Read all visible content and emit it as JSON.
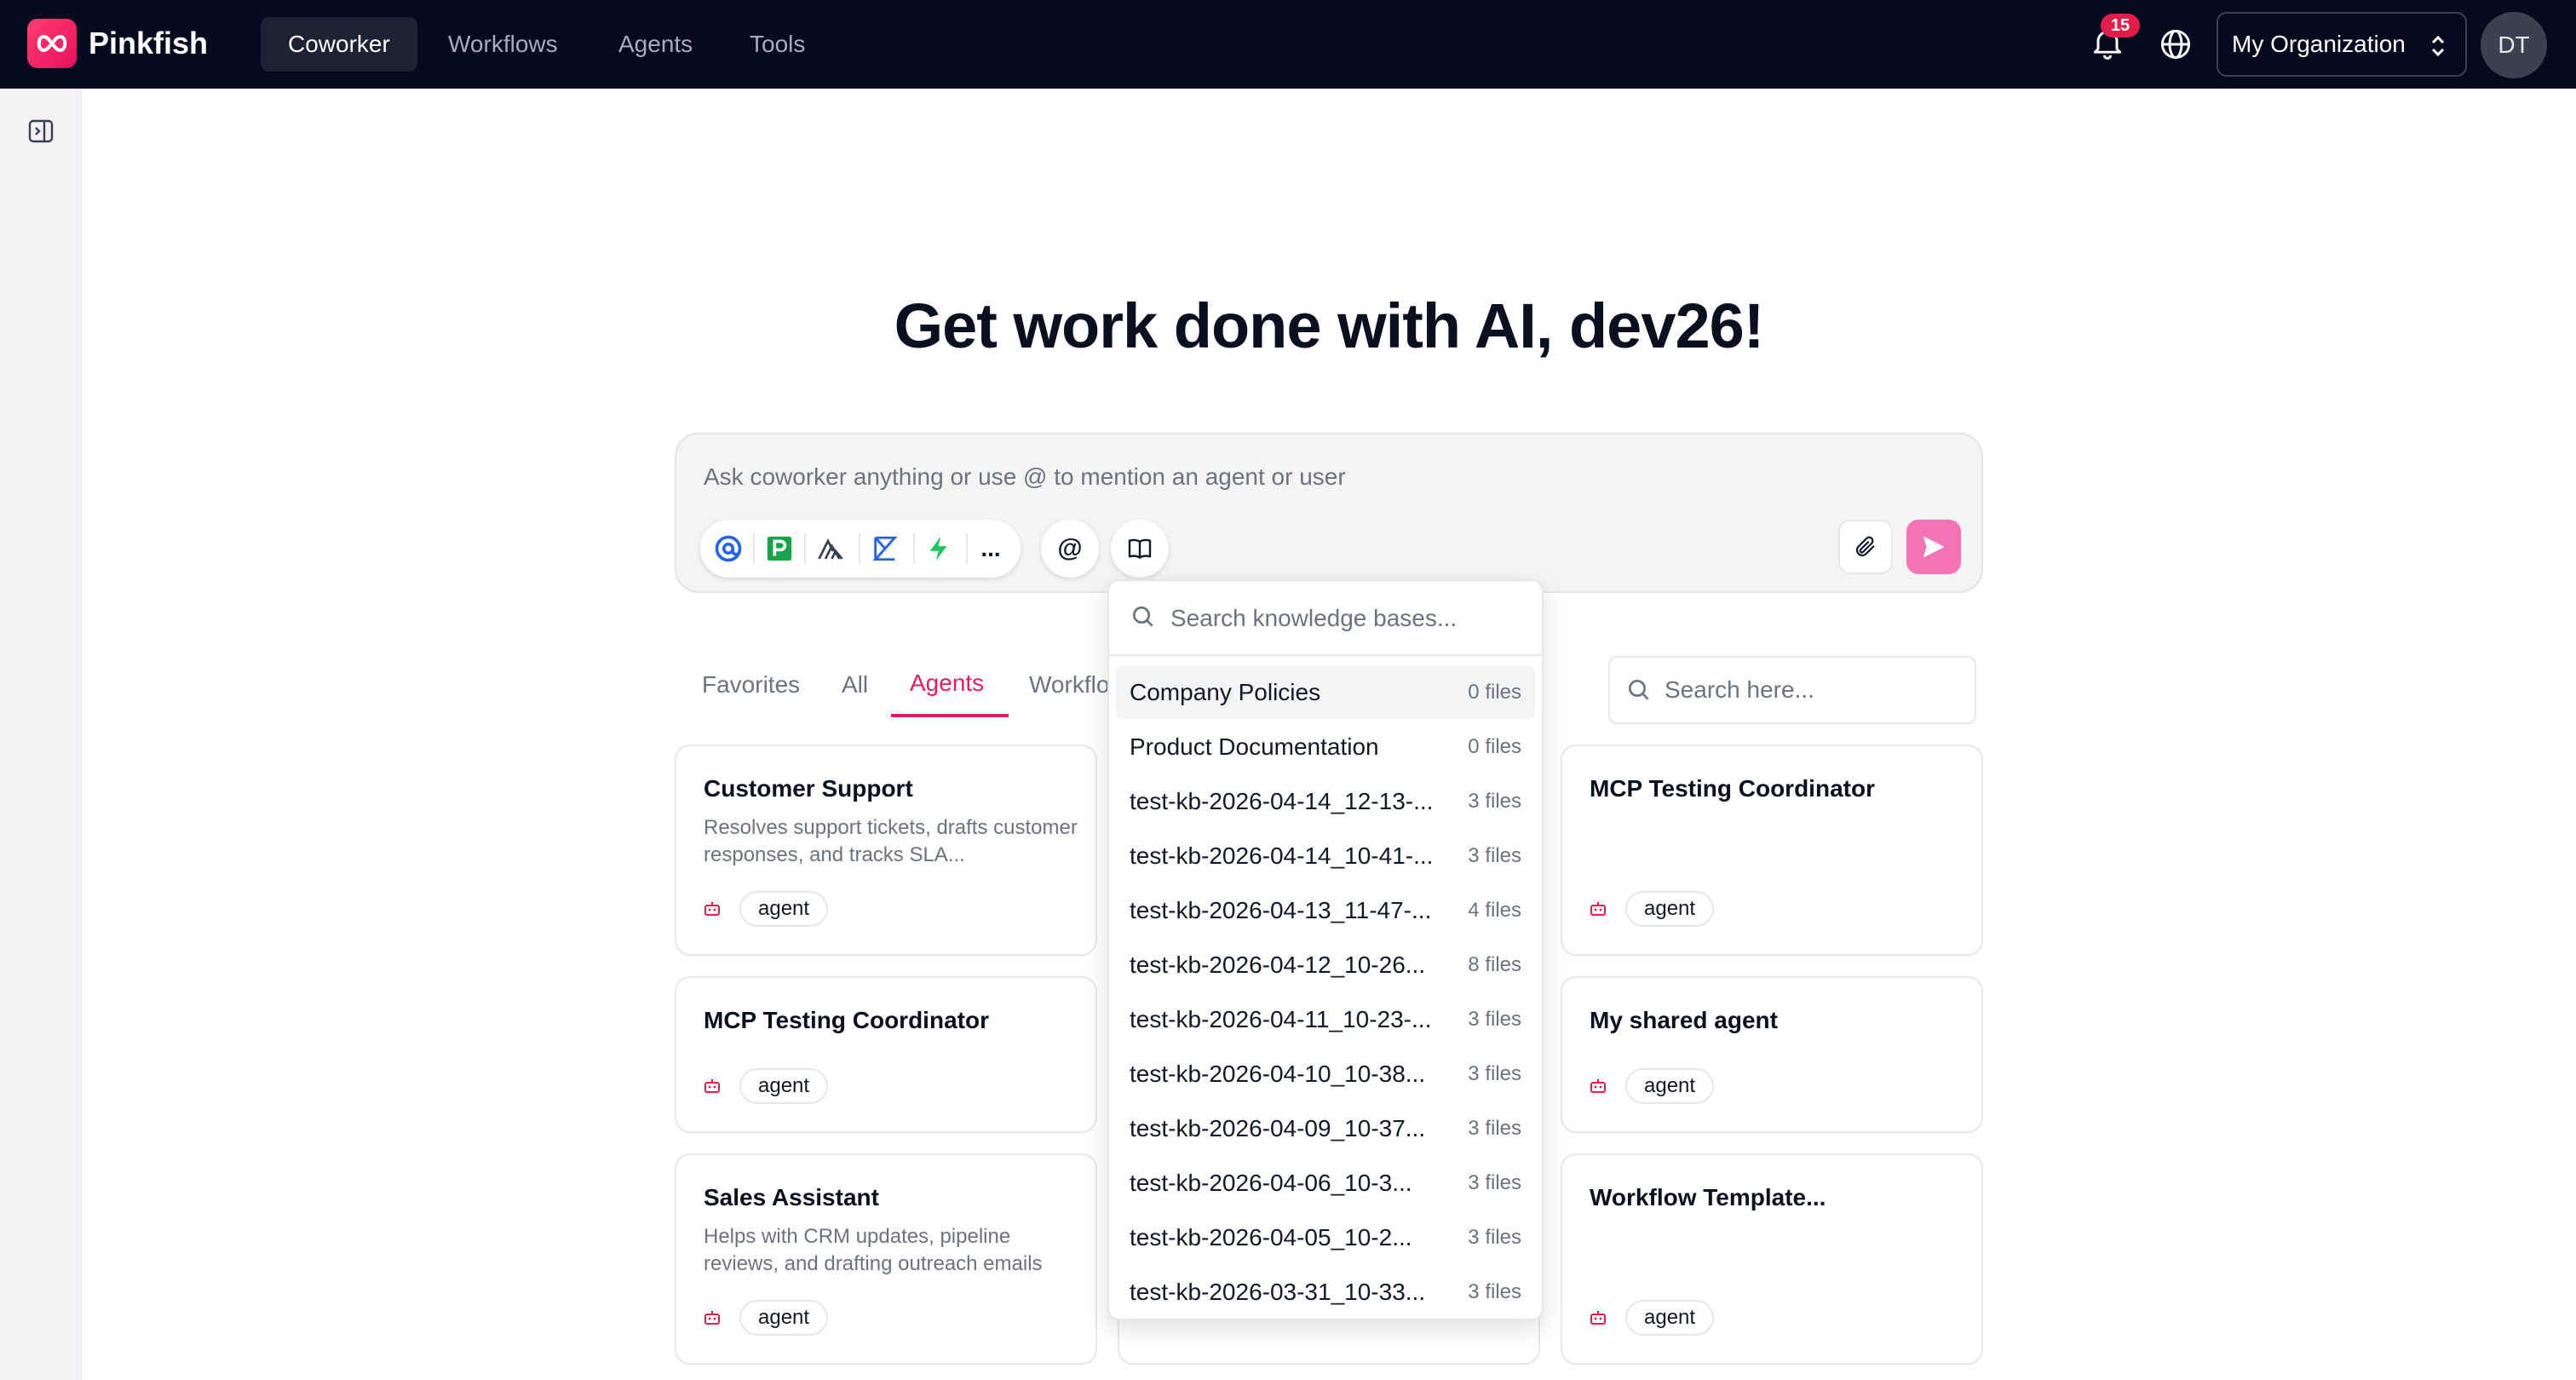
{
  "brand": {
    "name": "Pinkfish"
  },
  "nav": {
    "tabs": [
      {
        "label": "Coworker",
        "active": true
      },
      {
        "label": "Workflows",
        "active": false
      },
      {
        "label": "Agents",
        "active": false
      },
      {
        "label": "Tools",
        "active": false
      }
    ],
    "notification_count": "15",
    "organization": "My Organization",
    "avatar_initials": "DT"
  },
  "hero": {
    "title": "Get work done with AI, dev26!"
  },
  "composer": {
    "placeholder": "Ask coworker anything or use @ to mention an agent or user",
    "more_label": "...",
    "mention_label": "@",
    "tool_icons": [
      "at-sign-app-icon",
      "p-app-icon",
      "mountain-app-icon",
      "k-app-icon",
      "bolt-app-icon"
    ]
  },
  "filter_tabs": {
    "favorites": "Favorites",
    "all": "All",
    "agents": "Agents",
    "workflows": "Workflo"
  },
  "search_placeholder": "Search here...",
  "cards": [
    {
      "title": "Customer Support",
      "desc": "Resolves support tickets, drafts customer responses, and tracks SLA...",
      "tag": "agent"
    },
    {
      "title": "MCP Testing Coordinator",
      "desc": "",
      "tag": "agent"
    },
    {
      "title": "MCP Testing Coordinator",
      "desc": "",
      "tag": "agent"
    },
    {
      "title": "My shared agent",
      "desc": "",
      "tag": "agent"
    },
    {
      "title": "Sales Assistant",
      "desc": "Helps with CRM updates, pipeline reviews, and drafting outreach emails",
      "tag": "agent"
    },
    {
      "title": "Workflow Template...",
      "desc": "",
      "tag": "agent"
    }
  ],
  "knowledge_bases": {
    "placeholder": "Search knowledge bases...",
    "items": [
      {
        "name": "Company Policies",
        "count": "0 files"
      },
      {
        "name": "Product Documentation",
        "count": "0 files"
      },
      {
        "name": "test-kb-2026-04-14_12-13-...",
        "count": "3 files"
      },
      {
        "name": "test-kb-2026-04-14_10-41-...",
        "count": "3 files"
      },
      {
        "name": "test-kb-2026-04-13_11-47-...",
        "count": "4 files"
      },
      {
        "name": "test-kb-2026-04-12_10-26...",
        "count": "8 files"
      },
      {
        "name": "test-kb-2026-04-11_10-23-...",
        "count": "3 files"
      },
      {
        "name": "test-kb-2026-04-10_10-38...",
        "count": "3 files"
      },
      {
        "name": "test-kb-2026-04-09_10-37...",
        "count": "3 files"
      },
      {
        "name": "test-kb-2026-04-06_10-3...",
        "count": "3 files"
      },
      {
        "name": "test-kb-2026-04-05_10-2...",
        "count": "3 files"
      },
      {
        "name": "test-kb-2026-03-31_10-33...",
        "count": "3 files"
      }
    ]
  },
  "colors": {
    "accent": "#e11d64",
    "nav_bg": "#050b1e",
    "send_button": "#f472b6"
  }
}
